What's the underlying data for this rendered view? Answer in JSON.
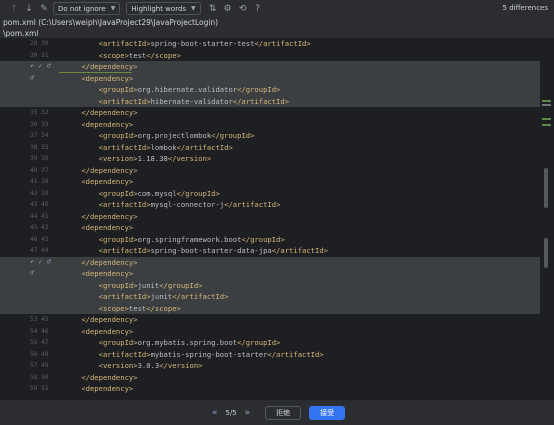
{
  "toolbar": {
    "prev_icon": "arrow-up-icon",
    "next_icon": "arrow-down-icon",
    "edit_icon": "pencil-icon",
    "ignore_option": "Do not ignore",
    "highlight_option": "Highlight words",
    "differences": "5 differences"
  },
  "file": {
    "header": "pom.xml (C:\\Users\\weiph\\JavaProject29\\JavaProjectLogin)",
    "short": "\\pom.xml"
  },
  "lines": [
    {
      "ln": "29 30",
      "code": "        <artifactId>spring-boot-starter-test</artifactId>",
      "kind": "normal"
    },
    {
      "ln": "30 31",
      "code": "        <scope>test</scope>",
      "kind": "normal"
    },
    {
      "ln": "",
      "code": "    </dependency>",
      "kind": "changed",
      "actions": "↶ ✓ ♂",
      "marker": true
    },
    {
      "ln": "",
      "code": "    <dependency>",
      "kind": "changed",
      "actions": "♂"
    },
    {
      "ln": "",
      "code": "        <groupId>org.hibernate.validator</groupId>",
      "kind": "changed"
    },
    {
      "ln": "",
      "code": "        <artifactId>hibernate-validator</artifactId>",
      "kind": "changed"
    },
    {
      "ln": "35 32",
      "code": "    </dependency>",
      "kind": "normal"
    },
    {
      "ln": "36 33",
      "code": "    <dependency>",
      "kind": "normal"
    },
    {
      "ln": "37 34",
      "code": "        <groupId>org.projectlombok</groupId>",
      "kind": "normal"
    },
    {
      "ln": "38 35",
      "code": "        <artifactId>lombok</artifactId>",
      "kind": "normal"
    },
    {
      "ln": "39 36",
      "code": "        <version>1.18.38</version>",
      "kind": "normal"
    },
    {
      "ln": "40 37",
      "code": "    </dependency>",
      "kind": "normal"
    },
    {
      "ln": "41 38",
      "code": "    <dependency>",
      "kind": "normal"
    },
    {
      "ln": "42 39",
      "code": "        <groupId>com.mysql</groupId>",
      "kind": "normal"
    },
    {
      "ln": "43 40",
      "code": "        <artifactId>mysql-connector-j</artifactId>",
      "kind": "normal"
    },
    {
      "ln": "44 41",
      "code": "    </dependency>",
      "kind": "normal"
    },
    {
      "ln": "45 42",
      "code": "    <dependency>",
      "kind": "normal"
    },
    {
      "ln": "46 43",
      "code": "        <groupId>org.springframework.boot</groupId>",
      "kind": "normal"
    },
    {
      "ln": "47 44",
      "code": "        <artifactId>spring-boot-starter-data-jpa</artifactId>",
      "kind": "normal"
    },
    {
      "ln": "",
      "code": "    </dependency>",
      "kind": "changed",
      "actions": "↶ ✓ ♂"
    },
    {
      "ln": "",
      "code": "    <dependency>",
      "kind": "changed",
      "actions": "♂"
    },
    {
      "ln": "",
      "code": "        <groupId>junit</groupId>",
      "kind": "changed"
    },
    {
      "ln": "",
      "code": "        <artifactId>junit</artifactId>",
      "kind": "changed"
    },
    {
      "ln": "",
      "code": "        <scope>test</scope>",
      "kind": "changed"
    },
    {
      "ln": "53 45",
      "code": "    </dependency>",
      "kind": "normal"
    },
    {
      "ln": "54 46",
      "code": "    <dependency>",
      "kind": "normal"
    },
    {
      "ln": "55 47",
      "code": "        <groupId>org.mybatis.spring.boot</groupId>",
      "kind": "normal"
    },
    {
      "ln": "56 48",
      "code": "        <artifactId>mybatis-spring-boot-starter</artifactId>",
      "kind": "normal"
    },
    {
      "ln": "57 49",
      "code": "        <version>3.0.3</version>",
      "kind": "normal"
    },
    {
      "ln": "58 50",
      "code": "    </dependency>",
      "kind": "normal"
    },
    {
      "ln": "59 51",
      "code": "    <dependency>",
      "kind": "normal"
    }
  ],
  "bottom": {
    "prev_icon": "double-chevron-left-icon",
    "next_icon": "double-chevron-right-icon",
    "position": "5/5",
    "reject": "拒绝",
    "accept": "接受"
  }
}
